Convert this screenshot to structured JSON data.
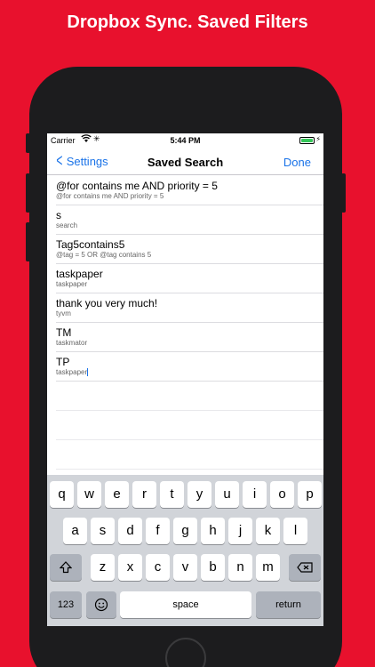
{
  "headline": "Dropbox Sync. Saved Filters",
  "status_bar": {
    "carrier": "Carrier",
    "time": "5:44 PM"
  },
  "nav": {
    "back_label": "Settings",
    "title": "Saved Search",
    "done_label": "Done"
  },
  "searches": [
    {
      "name": "@for contains me AND priority = 5",
      "query": "@for contains me AND priority = 5"
    },
    {
      "name": "s",
      "query": "search"
    },
    {
      "name": "Tag5contains5",
      "query": "@tag = 5 OR @tag contains 5"
    },
    {
      "name": "taskpaper",
      "query": "taskpaper"
    },
    {
      "name": "thank you very much!",
      "query": "tyvm"
    },
    {
      "name": "TM",
      "query": "taskmator"
    },
    {
      "name": "TP",
      "query": "taskpaper"
    }
  ],
  "keyboard": {
    "row1": [
      "q",
      "w",
      "e",
      "r",
      "t",
      "y",
      "u",
      "i",
      "o",
      "p"
    ],
    "row2": [
      "a",
      "s",
      "d",
      "f",
      "g",
      "h",
      "j",
      "k",
      "l"
    ],
    "row3": [
      "z",
      "x",
      "c",
      "v",
      "b",
      "n",
      "m"
    ],
    "numbers_label": "123",
    "space_label": "space",
    "return_label": "return"
  },
  "colors": {
    "background": "#E8112D",
    "accent": "#1a73e8"
  }
}
